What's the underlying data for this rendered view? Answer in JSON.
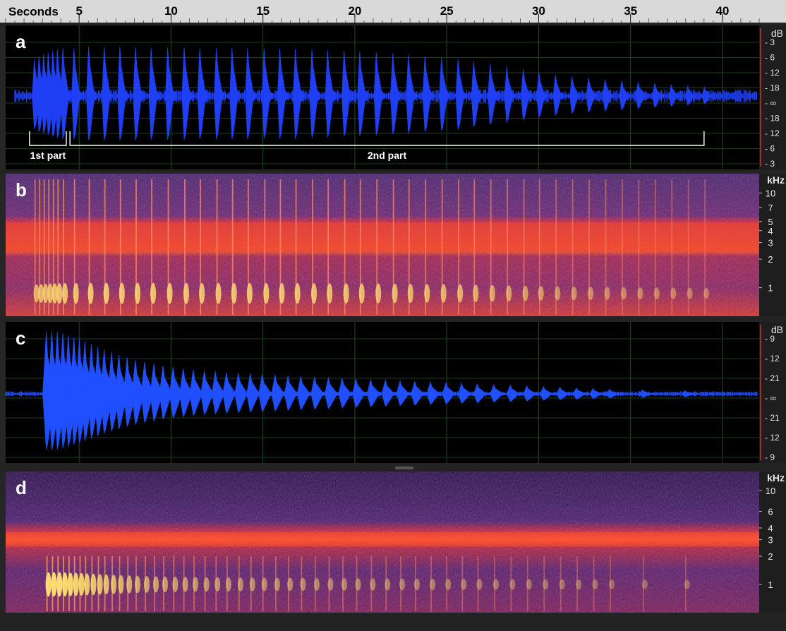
{
  "time_axis": {
    "label": "Seconds",
    "ticks": [
      5,
      10,
      15,
      20,
      25,
      30,
      35,
      40
    ],
    "range": [
      1,
      42
    ]
  },
  "panels": [
    {
      "id": "a",
      "letter": "a",
      "type": "waveform",
      "unit_label": "dB",
      "db_ticks": [
        "- 3",
        "- 6",
        "- 12",
        "- 18",
        "- ∞",
        "- 18",
        "- 12",
        "- 6",
        "- 3"
      ],
      "brackets": [
        {
          "label": "1st part",
          "start_s": 2.3,
          "end_s": 4.3
        },
        {
          "label": "2nd part",
          "start_s": 4.5,
          "end_s": 39.0
        }
      ]
    },
    {
      "id": "b",
      "letter": "b",
      "type": "spectrogram",
      "unit_label": "kHz",
      "khz_ticks": [
        10,
        7,
        5,
        4,
        3,
        2,
        1
      ]
    },
    {
      "id": "c",
      "letter": "c",
      "type": "waveform",
      "unit_label": "dB",
      "db_ticks": [
        "- 9",
        "- 12",
        "- 21",
        "- ∞",
        "- 21",
        "- 12",
        "- 9"
      ]
    },
    {
      "id": "d",
      "letter": "d",
      "type": "spectrogram",
      "unit_label": "kHz",
      "khz_ticks": [
        10,
        6,
        4,
        3,
        2,
        1
      ]
    }
  ],
  "chart_data": [
    {
      "type": "area",
      "panel": "a",
      "title": "",
      "xlabel": "Seconds",
      "ylabel": "dB",
      "xlim": [
        1,
        42
      ],
      "pulse_times_s": [
        2.6,
        2.85,
        3.1,
        3.35,
        3.6,
        3.85,
        4.15,
        4.75,
        5.55,
        6.4,
        7.25,
        8.1,
        8.95,
        9.85,
        10.75,
        11.6,
        12.5,
        13.35,
        14.2,
        15.1,
        15.95,
        16.8,
        17.7,
        18.55,
        19.45,
        20.3,
        21.2,
        22.1,
        22.95,
        23.85,
        24.75,
        25.65,
        26.5,
        27.4,
        28.3,
        29.2,
        30.05,
        30.95,
        31.85,
        32.75,
        33.65,
        34.55,
        35.45,
        36.35,
        37.25,
        38.15,
        39.05
      ],
      "pulse_amp": [
        0.55,
        0.6,
        0.62,
        0.65,
        0.68,
        0.7,
        0.72,
        0.72,
        0.74,
        0.74,
        0.74,
        0.74,
        0.73,
        0.73,
        0.73,
        0.72,
        0.72,
        0.72,
        0.72,
        0.71,
        0.71,
        0.71,
        0.7,
        0.69,
        0.68,
        0.67,
        0.66,
        0.64,
        0.62,
        0.6,
        0.58,
        0.56,
        0.52,
        0.48,
        0.44,
        0.4,
        0.36,
        0.32,
        0.29,
        0.27,
        0.25,
        0.23,
        0.21,
        0.19,
        0.17,
        0.15,
        0.13
      ],
      "noise_level": 0.1,
      "grid": true,
      "color": "#1f3ff5"
    },
    {
      "type": "heatmap",
      "panel": "b",
      "xlabel": "Seconds",
      "ylabel": "kHz",
      "xlim": [
        1,
        42
      ],
      "yticks_khz": [
        10,
        7,
        5,
        4,
        3,
        2,
        1
      ],
      "background_band_khz": [
        3.6,
        5.8
      ],
      "pulse_energy_khz": [
        0.8,
        1.6
      ],
      "pulse_times_ref": "a",
      "colormap": [
        "#1a0330",
        "#4a1a7a",
        "#a0205e",
        "#e8202a",
        "#ff8a1a",
        "#ffe070"
      ]
    },
    {
      "type": "area",
      "panel": "c",
      "title": "",
      "xlabel": "Seconds",
      "ylabel": "dB",
      "xlim": [
        1,
        42
      ],
      "pulse_times_s": [
        3.25,
        3.55,
        3.85,
        4.15,
        4.45,
        4.75,
        5.05,
        5.35,
        5.7,
        6.05,
        6.4,
        6.8,
        7.2,
        7.65,
        8.1,
        8.6,
        9.1,
        9.6,
        10.15,
        10.7,
        11.25,
        11.85,
        12.45,
        13.05,
        13.7,
        14.35,
        15.0,
        15.7,
        16.4,
        17.1,
        17.85,
        18.6,
        19.35,
        20.1,
        20.9,
        21.7,
        22.5,
        23.3,
        24.15,
        25.0,
        25.85,
        26.7,
        27.6,
        28.5,
        29.4,
        30.3,
        31.2,
        32.1,
        33.0,
        33.9,
        35.7,
        38.0
      ],
      "pulse_amp": [
        0.95,
        0.96,
        0.95,
        0.93,
        0.9,
        0.87,
        0.84,
        0.8,
        0.76,
        0.72,
        0.68,
        0.64,
        0.6,
        0.56,
        0.52,
        0.49,
        0.46,
        0.43,
        0.41,
        0.39,
        0.37,
        0.35,
        0.34,
        0.33,
        0.32,
        0.31,
        0.3,
        0.29,
        0.28,
        0.27,
        0.26,
        0.25,
        0.24,
        0.23,
        0.22,
        0.21,
        0.2,
        0.19,
        0.18,
        0.17,
        0.16,
        0.15,
        0.14,
        0.13,
        0.12,
        0.11,
        0.1,
        0.09,
        0.08,
        0.07,
        0.06,
        0.05
      ],
      "noise_level": 0.04,
      "grid": true,
      "color": "#1f4fff"
    },
    {
      "type": "heatmap",
      "panel": "d",
      "xlabel": "Seconds",
      "ylabel": "kHz",
      "xlim": [
        1,
        42
      ],
      "yticks_khz": [
        10,
        6,
        4,
        3,
        2,
        1
      ],
      "background_band_khz": [
        3.6,
        4.8
      ],
      "pulse_energy_khz": [
        0.7,
        1.5
      ],
      "pulse_times_ref": "c",
      "colormap": [
        "#1a0330",
        "#4a1a7a",
        "#a0205e",
        "#e8202a",
        "#ff8a1a",
        "#ffe070"
      ]
    }
  ]
}
